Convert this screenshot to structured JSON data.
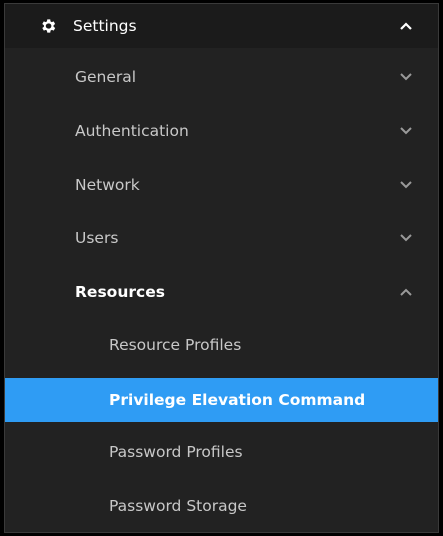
{
  "settings": {
    "label": "Settings",
    "icon": "gear-icon",
    "expanded": true
  },
  "menu": {
    "general": "General",
    "authentication": "Authentication",
    "network": "Network",
    "users": "Users",
    "resources": "Resources"
  },
  "resources_submenu": {
    "resource_profiles": "Resource Profiles",
    "privilege_elevation_command": "Privilege Elevation Command",
    "password_profiles": "Password Profiles",
    "password_storage": "Password Storage"
  },
  "colors": {
    "panel_bg": "#222222",
    "header_bg": "#1b1b1b",
    "active_bg": "#2f9cf4",
    "text": "#c8c8c8",
    "text_active": "#ffffff"
  }
}
